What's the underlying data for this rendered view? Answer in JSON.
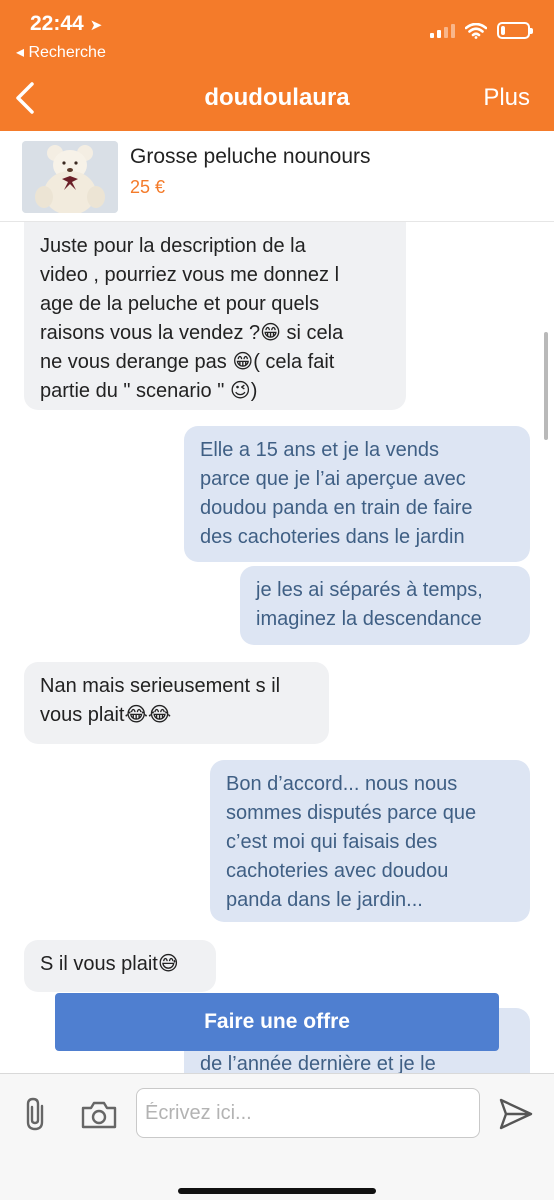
{
  "status_bar": {
    "time": "22:44",
    "back_to_app": "◂ Recherche"
  },
  "nav": {
    "title": "doudoulaura",
    "more": "Plus"
  },
  "product": {
    "title": "Grosse peluche nounours",
    "price": "25 €"
  },
  "messages": [
    {
      "direction": "in",
      "text": "Juste pour la description de la\nvideo , pourriez vous me donnez l\nage de la peluche et pour quels\nraisons vous la vendez ?😁  si cela\nne vous derange pas 😁( cela fait\npartie du \" scenario \" 😉)"
    },
    {
      "direction": "out",
      "text": "Elle a 15 ans et je la vends\nparce que je l’ai aperçue avec\ndoudou panda en train de faire\ndes cachoteries dans le jardin"
    },
    {
      "direction": "out",
      "text": "je les ai séparés à temps,\nimaginez la descendance"
    },
    {
      "direction": "in",
      "text": "Nan mais serieusement s il\nvous plait😂😂"
    },
    {
      "direction": "out",
      "text": "Bon d’accord... nous nous\nsommes disputés parce que\nc’est moi qui faisais des\ncachoteries avec doudou\npanda dans le jardin..."
    },
    {
      "direction": "in",
      "text": "S il vous plait😅"
    },
    {
      "direction": "out",
      "text": "de l’année dernière et je le"
    }
  ],
  "offer_button": "Faire une offre",
  "composer": {
    "placeholder": "Écrivez ici..."
  },
  "colors": {
    "brand": "#f47b2a",
    "offer": "#4f7fd0",
    "outgoing_bubble": "#dde5f3",
    "incoming_bubble": "#f0f1f3"
  },
  "icons": [
    "location-arrow-icon",
    "signal-icon",
    "wifi-icon",
    "battery-icon",
    "back-chevron-icon",
    "paperclip-icon",
    "camera-icon",
    "send-icon"
  ]
}
